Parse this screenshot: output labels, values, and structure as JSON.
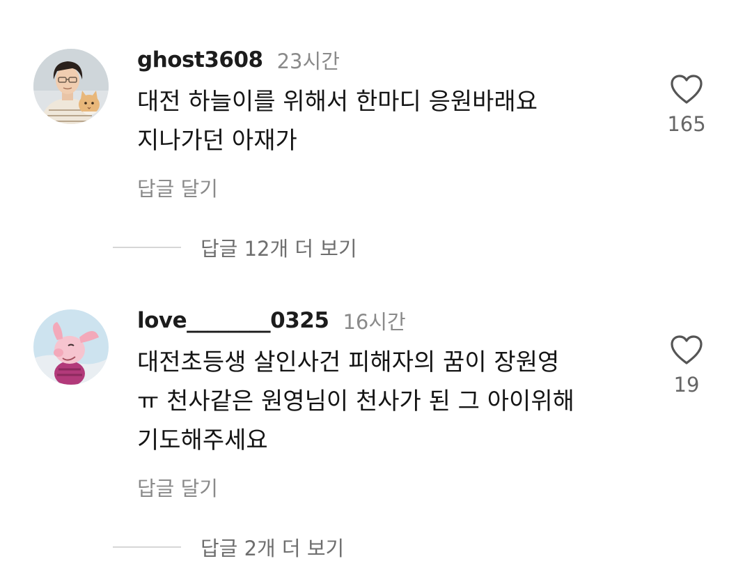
{
  "comments": [
    {
      "username": "ghost3608",
      "time": "23시간",
      "lines": [
        "대전 하늘이를 위해서 한마디 응원바래요",
        "지나가던 아재가"
      ],
      "reply_label": "답글 달기",
      "likes": "165",
      "avatar_icon": "portrait-with-cat-avatar",
      "view_more": "답글 12개 더 보기"
    },
    {
      "username": "love________0325",
      "time": "16시간",
      "lines": [
        "대전초등생 살인사건 피해자의 꿈이 장원영",
        "ㅠ 천사같은 원영님이 천사가 된 그 아이위해",
        "기도해주세요"
      ],
      "reply_label": "답글 달기",
      "likes": "19",
      "avatar_icon": "piglet-cartoon-avatar",
      "view_more": "답글 2개 더 보기"
    }
  ],
  "icons": {
    "like": "heart-outline-icon"
  },
  "colors": {
    "secondary_text": "#8a8a8a",
    "divider": "#d6d6d6"
  }
}
